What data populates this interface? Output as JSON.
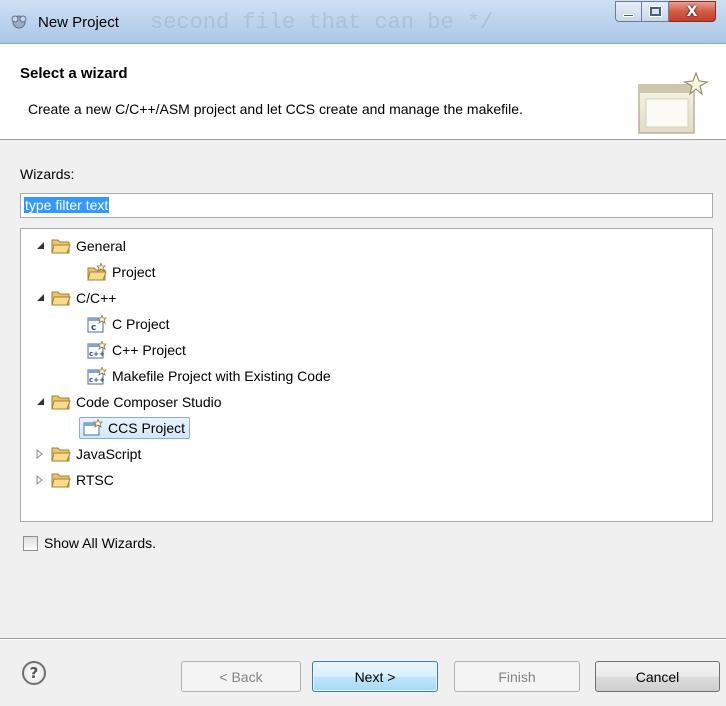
{
  "window": {
    "title": "New Project",
    "watermark": "second file that can be */",
    "close_glyph": "X"
  },
  "banner": {
    "title": "Select a wizard",
    "description": "Create a new C/C++/ASM project and let CCS create and manage the makefile."
  },
  "wizards": {
    "label": "Wizards:",
    "filter_value": "type filter text"
  },
  "tree": {
    "items": [
      {
        "label": "General",
        "icon": "folder-open-icon",
        "expanded": true
      },
      {
        "label": "Project",
        "icon": "project-wizard-icon"
      },
      {
        "label": "C/C++",
        "icon": "folder-open-icon",
        "expanded": true
      },
      {
        "label": "C Project",
        "icon": "c-project-icon"
      },
      {
        "label": "C++ Project",
        "icon": "cpp-project-icon"
      },
      {
        "label": "Makefile Project with Existing Code",
        "icon": "cpp-project-icon"
      },
      {
        "label": "Code Composer Studio",
        "icon": "folder-open-icon",
        "expanded": true
      },
      {
        "label": "CCS Project",
        "icon": "ccs-project-icon",
        "selected": true
      },
      {
        "label": "JavaScript",
        "icon": "folder-icon",
        "expanded": false
      },
      {
        "label": "RTSC",
        "icon": "folder-icon",
        "expanded": false
      }
    ]
  },
  "show_all": {
    "label": "Show All Wizards.",
    "checked": false
  },
  "buttons": {
    "help": "?",
    "back": "< Back",
    "next": "Next >",
    "finish": "Finish",
    "cancel": "Cancel"
  }
}
